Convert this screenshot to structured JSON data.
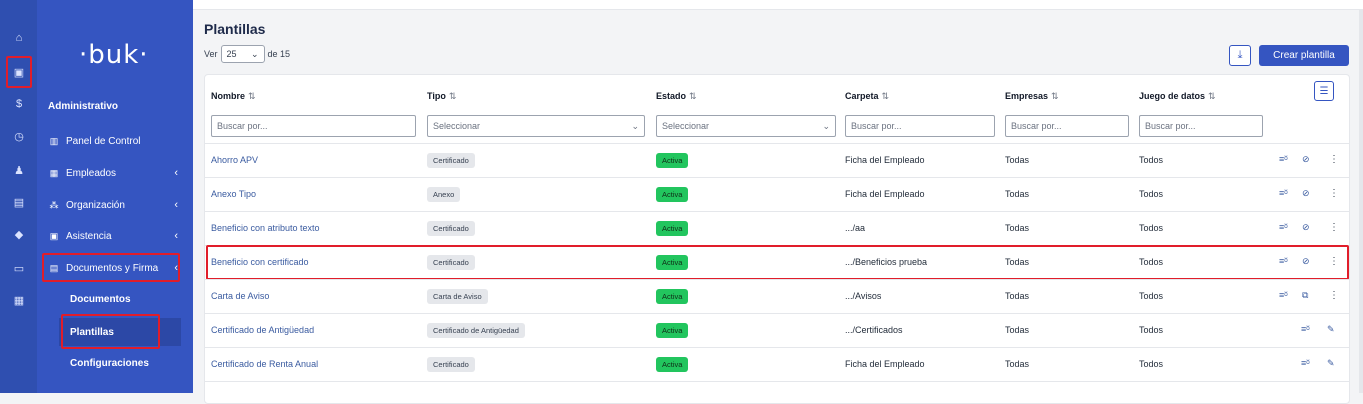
{
  "rail": {
    "icons": [
      "home-icon",
      "clipboard-icon",
      "dollar-icon",
      "clock-icon",
      "people-icon",
      "briefcase-icon",
      "graduation-icon",
      "folder-icon",
      "store-icon"
    ]
  },
  "sidebar": {
    "logo": "·buk·",
    "section": "Administrativo",
    "items": [
      {
        "label": "Panel de Control",
        "icon": "dashboard-icon",
        "chevron": ""
      },
      {
        "label": "Empleados",
        "icon": "employees-icon",
        "chevron": "‹"
      },
      {
        "label": "Organización",
        "icon": "org-icon",
        "chevron": "‹"
      },
      {
        "label": "Asistencia",
        "icon": "calendar-icon",
        "chevron": "‹"
      },
      {
        "label": "Documentos y Firma",
        "icon": "documents-icon",
        "chevron": "‹"
      }
    ],
    "subitems": [
      "Documentos",
      "Plantillas",
      "Configuraciones"
    ]
  },
  "page": {
    "title": "Plantillas",
    "ver_label": "Ver",
    "per_page": "25",
    "of_label": "de 15",
    "create_label": "Crear plantilla"
  },
  "table": {
    "columns": [
      "Nombre",
      "Tipo",
      "Estado",
      "Carpeta",
      "Empresas",
      "Juego de datos"
    ],
    "filters": [
      "Buscar por...",
      "Seleccionar",
      "Seleccionar",
      "Buscar por...",
      "Buscar por...",
      "Buscar por..."
    ],
    "rows": [
      {
        "nombre": "Ahorro APV",
        "tipo": "Certificado",
        "estado": "Activa",
        "carpeta": "Ficha del Empleado",
        "empresas": "Todas",
        "juego": "Todos"
      },
      {
        "nombre": "Anexo Tipo",
        "tipo": "Anexo",
        "estado": "Activa",
        "carpeta": "Ficha del Empleado",
        "empresas": "Todas",
        "juego": "Todos"
      },
      {
        "nombre": "Beneficio con atributo texto",
        "tipo": "Certificado",
        "estado": "Activa",
        "carpeta": ".../aa",
        "empresas": "Todas",
        "juego": "Todos"
      },
      {
        "nombre": "Beneficio con certificado",
        "tipo": "Certificado",
        "estado": "Activa",
        "carpeta": ".../Beneficios prueba",
        "empresas": "Todas",
        "juego": "Todos"
      },
      {
        "nombre": "Carta de Aviso",
        "tipo": "Carta de Aviso",
        "estado": "Activa",
        "carpeta": ".../Avisos",
        "empresas": "Todas",
        "juego": "Todos"
      },
      {
        "nombre": "Certificado de Antigüedad",
        "tipo": "Certificado de Antigüedad",
        "estado": "Activa",
        "carpeta": ".../Certificados",
        "empresas": "Todas",
        "juego": "Todos"
      },
      {
        "nombre": "Certificado de Renta Anual",
        "tipo": "Certificado",
        "estado": "Activa",
        "carpeta": "Ficha del Empleado",
        "empresas": "Todas",
        "juego": "Todos"
      }
    ]
  },
  "colors": {
    "brand": "#3555c1",
    "rail": "#2f4fb0",
    "active": "#22c55e",
    "highlight": "#e11d2a"
  }
}
